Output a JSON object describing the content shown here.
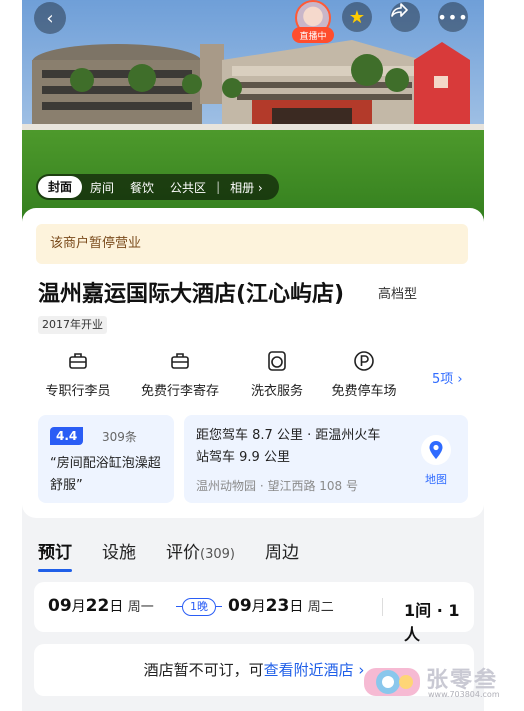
{
  "header": {
    "back_icon": "chevron-left-icon",
    "live_label": "直播中",
    "favorite_icon": "star-icon",
    "share_icon": "share-icon",
    "more_icon": "more-icon"
  },
  "photo_tabs": [
    {
      "label": "封面",
      "active": true
    },
    {
      "label": "房间",
      "active": false
    },
    {
      "label": "餐饮",
      "active": false
    },
    {
      "label": "公共区",
      "active": false
    },
    {
      "label": "相册 ›",
      "active": false
    }
  ],
  "hotel": {
    "notice": "该商户暂停营业",
    "name": "温州嘉运国际大酒店(江心屿店)",
    "type": "高档型",
    "opened": "2017年开业"
  },
  "amenities": [
    {
      "label": "专职行李员",
      "icon": "luggage-icon"
    },
    {
      "label": "免费行李寄存",
      "icon": "luggage-storage-icon"
    },
    {
      "label": "洗衣服务",
      "icon": "laundry-icon"
    },
    {
      "label": "免费停车场",
      "icon": "parking-icon"
    }
  ],
  "amenities_more": "5项 ›",
  "rating": {
    "score": "4.4",
    "count": "309条",
    "quote": "“房间配浴缸泡澡超舒服”"
  },
  "location": {
    "distance": "距您驾车 8.7 公里 · 距温州火车站驾车 9.9 公里",
    "address": "温州动物园 · 望江西路 108 号",
    "map_label": "地图"
  },
  "tabs": [
    {
      "label": "预订",
      "count": "",
      "active": true
    },
    {
      "label": "设施",
      "count": "",
      "active": false
    },
    {
      "label": "评价",
      "count": "(309)",
      "active": false
    },
    {
      "label": "周边",
      "count": "",
      "active": false
    }
  ],
  "booking": {
    "checkin_month": "09",
    "checkin_day": "22",
    "checkin_weekday": "周一",
    "nights": "1晚",
    "checkout_month": "09",
    "checkout_day": "23",
    "checkout_weekday": "周二",
    "rooms_guests": "1间 · 1人"
  },
  "unavailable": {
    "text": "酒店暂不可订，可",
    "link": "查看附近酒店 ›"
  },
  "watermark": {
    "text": "张零叁",
    "url": "www.703804.com"
  },
  "colors": {
    "accent": "#1f5fe8",
    "notice_bg": "#fdf3dc",
    "live_red": "#ff4d2d"
  }
}
